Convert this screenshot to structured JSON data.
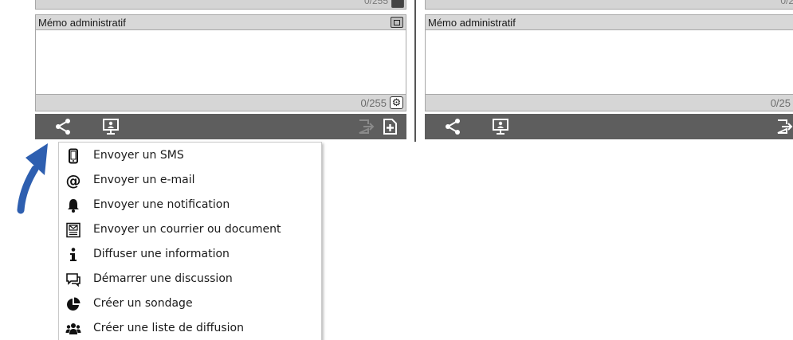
{
  "left_panel": {
    "memo_title": "Mémo administratif",
    "memo_counter": "0/255",
    "prev_counter": "0/255"
  },
  "right_panel": {
    "memo_title": "Mémo administratif",
    "memo_counter": "0/25",
    "prev_counter": "0/2"
  },
  "toolbar_icons": [
    "share-icon",
    "presentation-icon",
    "export-icon",
    "add-document-icon"
  ],
  "context_menu": {
    "items": [
      {
        "label": "Envoyer un SMS",
        "icon": "mobile-phone-icon"
      },
      {
        "label": "Envoyer un e-mail",
        "icon": "at-sign-icon"
      },
      {
        "label": "Envoyer une notification",
        "icon": "bell-icon"
      },
      {
        "label": "Envoyer un courrier ou document",
        "icon": "letter-document-icon"
      },
      {
        "label": "Diffuser une information",
        "icon": "info-icon"
      },
      {
        "label": "Démarrer une discussion",
        "icon": "chat-bubble-icon"
      },
      {
        "label": "Créer un sondage",
        "icon": "pie-chart-icon"
      },
      {
        "label": "Créer une liste de diffusion",
        "icon": "users-group-icon"
      }
    ]
  },
  "colors": {
    "toolbar_bg": "#5e5e5e",
    "header_bg": "#d8d8d8",
    "arrow": "#2e5fb0"
  }
}
